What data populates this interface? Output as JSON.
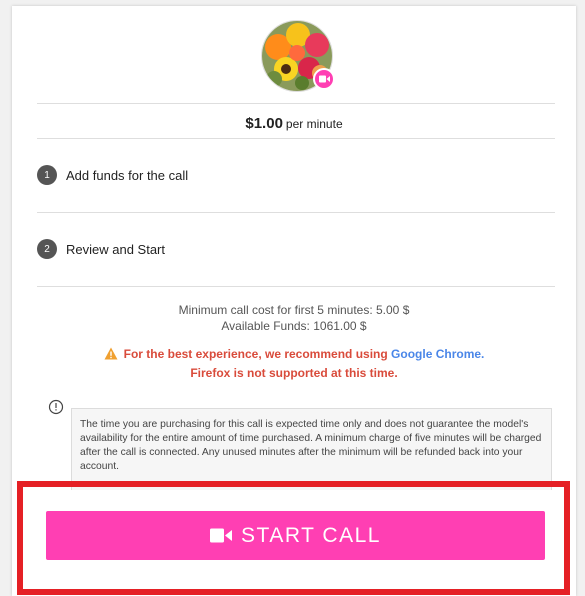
{
  "profile": {
    "avatar_icon": "flower-bouquet-avatar",
    "badge_icon": "video-camera-icon"
  },
  "pricing": {
    "amount": "$1.00",
    "unit": "per minute"
  },
  "steps": [
    {
      "number": "1",
      "label": "Add funds for the call"
    },
    {
      "number": "2",
      "label": "Review and Start"
    }
  ],
  "summary": {
    "minimum_cost": "Minimum call cost for first 5 minutes: 5.00 $",
    "available_funds": "Available Funds: 1061.00 $"
  },
  "browser_warning": {
    "text_before": "For the best experience, we recommend using",
    "link_text": "Google Chrome",
    "text_after": ".",
    "line2": "Firefox is not supported at this time."
  },
  "disclaimer": {
    "text": "The time you are purchasing for this call is expected time only and does not guarantee the model's availability for the entire amount of time purchased. A minimum charge of five minutes will be charged after the call is connected. Any unused minutes after the minimum will be refunded back into your account."
  },
  "start_button": {
    "label": "START CALL",
    "icon": "video-camera-icon"
  },
  "colors": {
    "accent_pink": "#ff3fb3",
    "warning_red": "#d94b3b",
    "link_blue": "#4a86e8",
    "highlight_red": "#e52025"
  }
}
